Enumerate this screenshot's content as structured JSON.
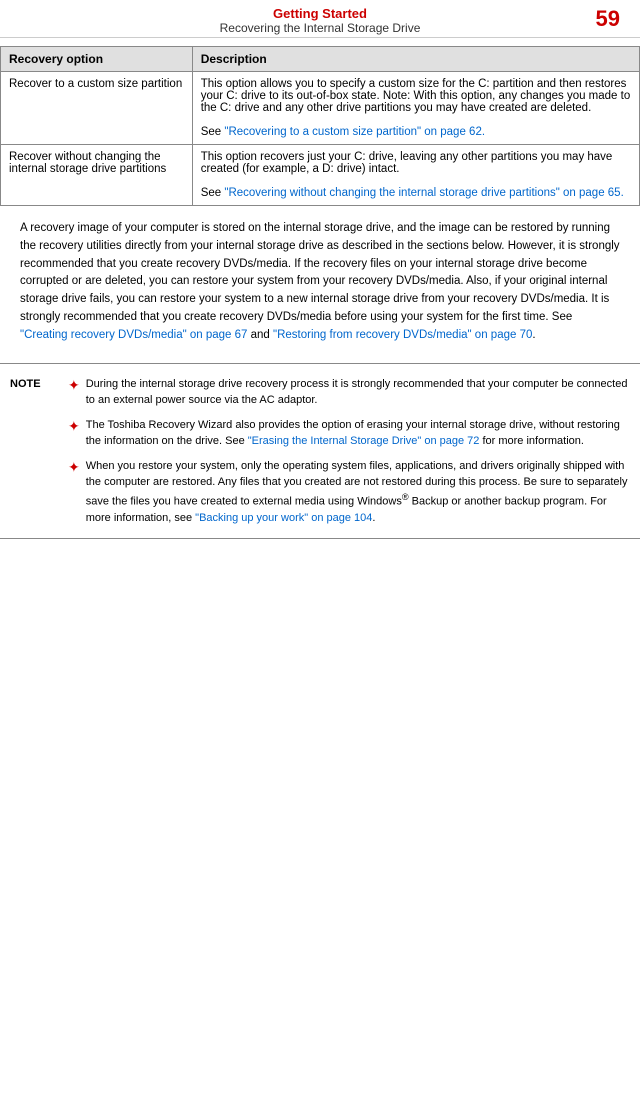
{
  "header": {
    "title": "Getting Started",
    "subtitle": "Recovering the Internal Storage Drive",
    "page_number": "59"
  },
  "table": {
    "col1_header": "Recovery option",
    "col2_header": "Description",
    "rows": [
      {
        "option": "Recover to a custom size partition",
        "description_main": "This option allows you to specify a custom size for the C: partition and then restores your C: drive to its out-of-box state. Note: With this option, any changes you made to the C: drive and any other drive partitions you may have created are deleted.",
        "description_link": "See “Recovering to a custom size partition” on page 62."
      },
      {
        "option": "Recover without changing the internal storage drive partitions",
        "description_main": "This option recovers just your C: drive, leaving any other partitions you may have created (for example, a D: drive) intact.",
        "description_link": "See “Recovering without changing the internal storage drive partitions” on page 65."
      }
    ]
  },
  "body_text": "A recovery image of your computer is stored on the internal storage drive, and the image can be restored by running the recovery utilities directly from your internal storage drive as described in the sections below. However, it is strongly recommended that you create recovery DVDs/media. If the recovery files on your internal storage drive become corrupted or are deleted, you can restore your system from your recovery DVDs/media. Also, if your original internal storage drive fails, you can restore your system to a new internal storage drive from your recovery DVDs/media. It is strongly recommended that you create recovery DVDs/media before using your system for the first time. See “Creating recovery DVDs/media” on page 67 and “Restoring from recovery DVDs/media” on page 70.",
  "body_link1": "“Creating recovery DVDs/media” on page 67",
  "body_link2": "“Restoring from recovery DVDs/media” on page 70",
  "note": {
    "label": "NOTE",
    "items": [
      "During the internal storage drive recovery process it is strongly recommended that your computer be connected to an external power source via the AC adaptor.",
      "The Toshiba Recovery Wizard also provides the option of erasing your internal storage drive, without restoring the information on the drive. See “Erasing the Internal Storage Drive” on page 72 for more information.",
      "When you restore your system, only the operating system files, applications, and drivers originally shipped with the computer are restored. Any files that you created are not restored during this process. Be sure to separately save the files you have created to external media using Windows® Backup or another backup program. For more information, see “Backing up your work” on page 104."
    ],
    "link_text2": "“Erasing the Internal Storage Drive” on page 72",
    "link_text3": "“Backing up your work” on page 104"
  }
}
